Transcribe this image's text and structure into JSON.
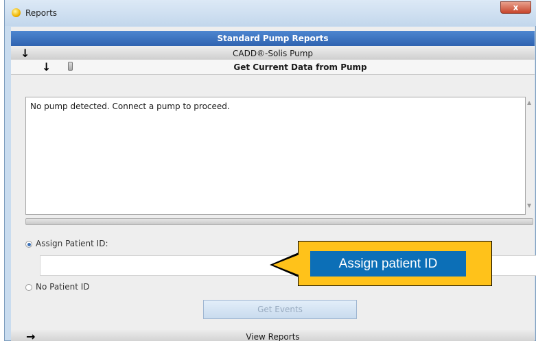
{
  "window": {
    "title": "Reports",
    "close_symbol": "x"
  },
  "header": {
    "title": "Standard Pump Reports"
  },
  "pump_row": {
    "label": "CADD®-Solis Pump"
  },
  "data_row": {
    "label": "Get Current Data from Pump"
  },
  "status_text": "No pump detected. Connect a pump to proceed.",
  "patient": {
    "assign_label": "Assign Patient ID:",
    "assign_selected": true,
    "input_value": "",
    "no_id_label": "No Patient ID",
    "get_events_label": "Get Events"
  },
  "view_reports": {
    "label": "View Reports"
  },
  "callout": {
    "text": "Assign patient ID"
  }
}
